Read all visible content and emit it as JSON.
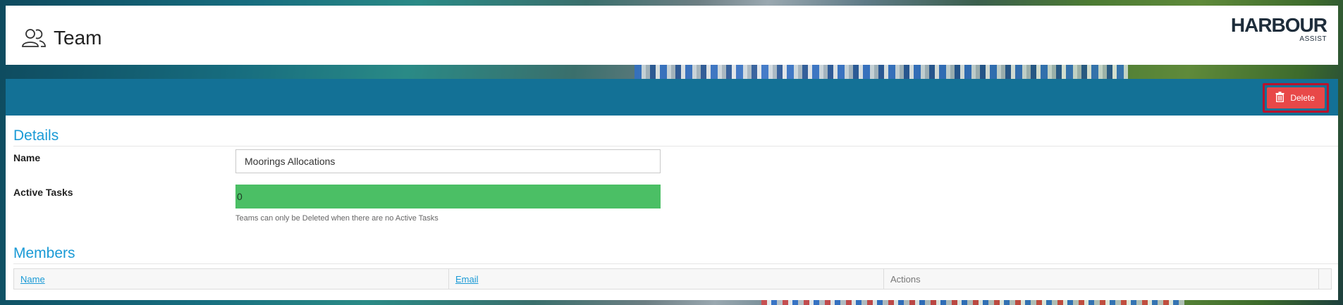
{
  "header": {
    "title": "Team",
    "icon": "team-icon",
    "logo_brand": "HARBOUR",
    "logo_sub": "ASSIST"
  },
  "toolbar": {
    "delete_label": "Delete",
    "delete_icon": "trash-icon",
    "bar_color": "#137196",
    "delete_color": "#e84848"
  },
  "details": {
    "title": "Details",
    "name_label": "Name",
    "name_value": "Moorings Allocations",
    "active_tasks_label": "Active Tasks",
    "active_tasks_value": "0",
    "active_tasks_color": "#4bbf65",
    "help_text": "Teams can only be Deleted when there are no Active Tasks"
  },
  "members": {
    "title": "Members",
    "columns": [
      "Name",
      "Email",
      "Actions"
    ]
  },
  "accent_color": "#1a9ad6"
}
